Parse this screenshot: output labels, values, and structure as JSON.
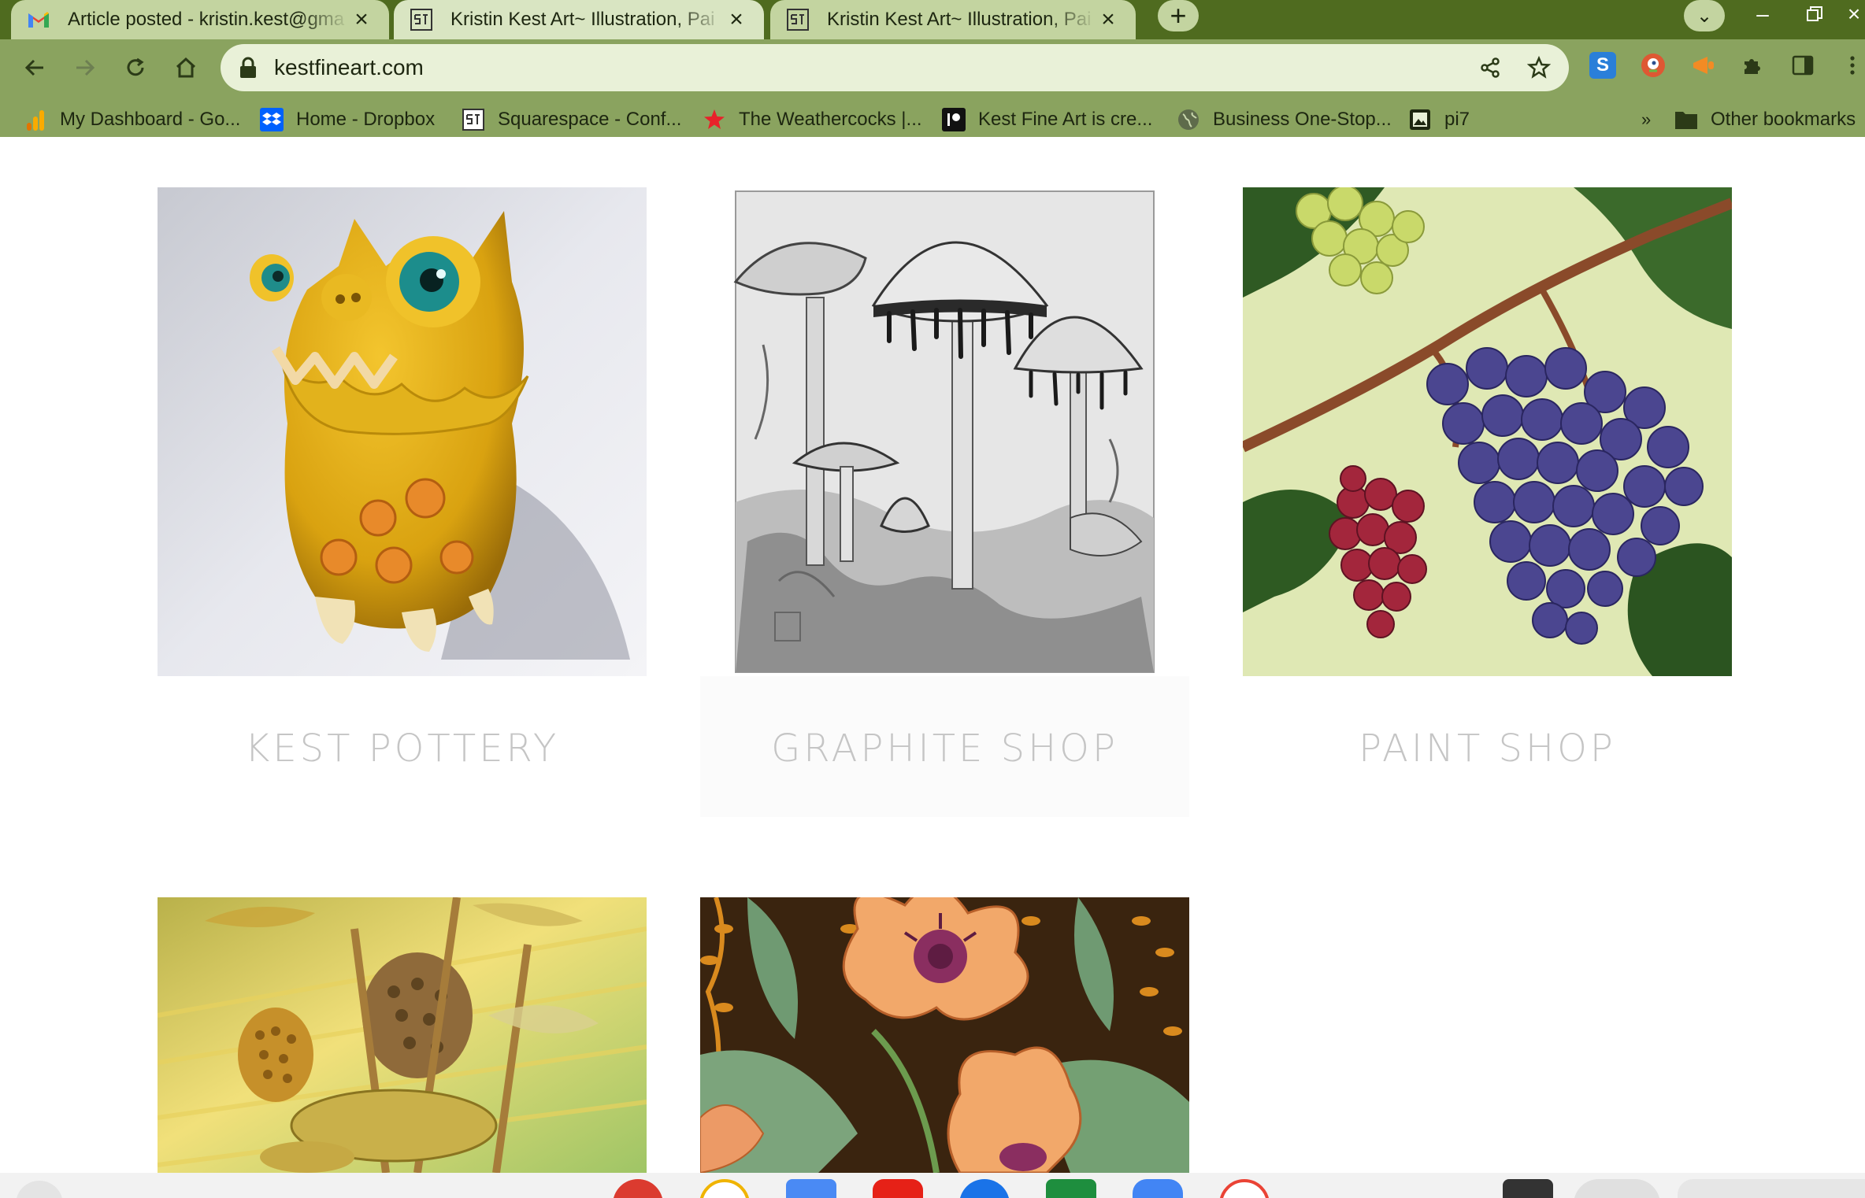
{
  "browser": {
    "tabs": [
      {
        "title": "Article posted - kristin.kest@gma",
        "favicon": "gmail-icon"
      },
      {
        "title": "Kristin Kest Art~ Illustration, Pai",
        "favicon": "squarespace-icon"
      },
      {
        "title": "Kristin Kest Art~ Illustration, Pai",
        "favicon": "squarespace-icon"
      }
    ],
    "new_tab_label": "+",
    "url": "kestfineart.com",
    "bookmarks": [
      {
        "label": "My Dashboard - Go...",
        "icon": "analytics-icon"
      },
      {
        "label": "Home - Dropbox",
        "icon": "dropbox-icon"
      },
      {
        "label": "Squarespace - Conf...",
        "icon": "squarespace-icon"
      },
      {
        "label": "The Weathercocks |...",
        "icon": "star-icon"
      },
      {
        "label": "Kest Fine Art is cre...",
        "icon": "patreon-icon"
      },
      {
        "label": "Business One-Stop...",
        "icon": "globe-icon"
      },
      {
        "label": "pi7",
        "icon": "image-icon"
      }
    ],
    "bookmarks_overflow": "»",
    "other_bookmarks": "Other bookmarks",
    "colors": {
      "frame": "#4f6b1f",
      "toolbar": "#8aa35f",
      "omnibox": "#e9f1d8"
    }
  },
  "shop": {
    "categories": [
      {
        "label": "KEST POTTERY",
        "art": "yellow-ceramic-creature"
      },
      {
        "label": "GRAPHITE SHOP",
        "art": "graphite-mushrooms"
      },
      {
        "label": "PAINT SHOP",
        "art": "grapes-on-vine"
      },
      {
        "label": "",
        "art": "yellow-forest-creatures"
      },
      {
        "label": "",
        "art": "orange-poppies"
      }
    ],
    "caption_color": "#c5c5c5"
  }
}
